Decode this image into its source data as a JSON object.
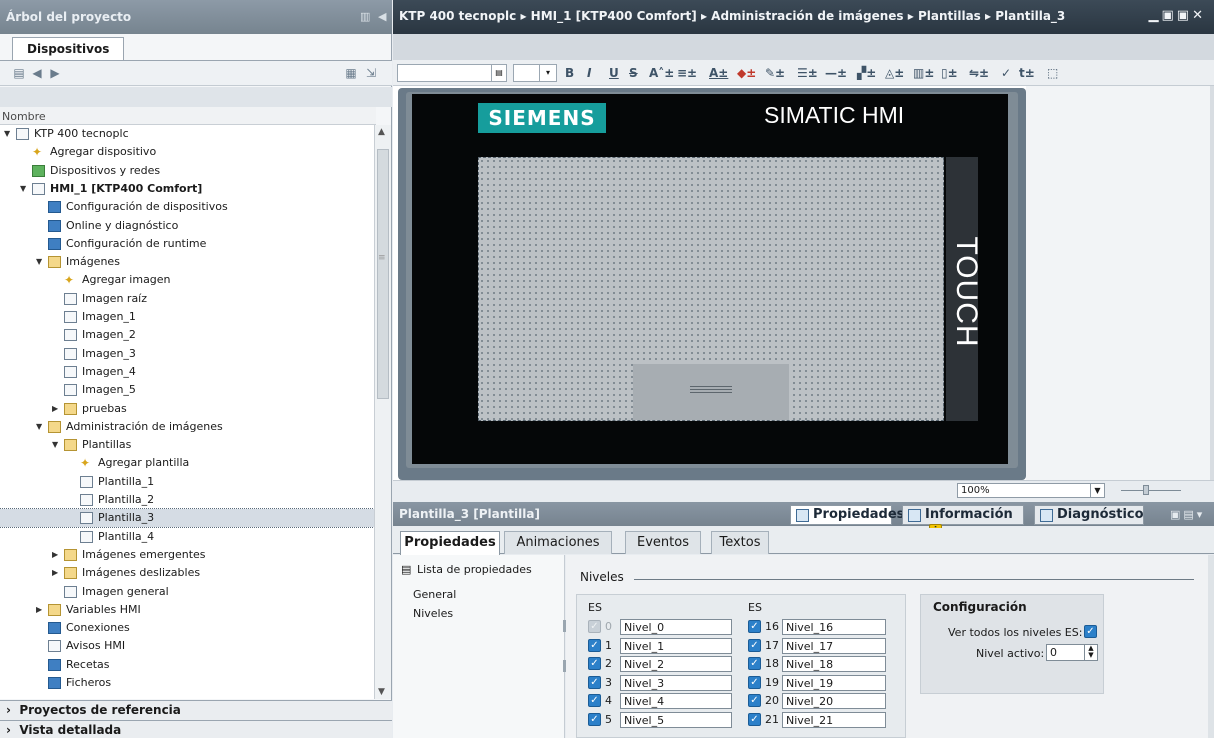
{
  "left_panel": {
    "title": "Árbol del proyecto",
    "tab": "Dispositivos",
    "column_header": "Nombre",
    "tree": [
      {
        "label": "KTP 400 tecnoplc",
        "level": 0,
        "expand": "open",
        "icon": "page"
      },
      {
        "label": "Agregar dispositivo",
        "level": 1,
        "expand": "none",
        "icon": "star"
      },
      {
        "label": "Dispositivos y redes",
        "level": 1,
        "expand": "none",
        "icon": "green"
      },
      {
        "label": "HMI_1 [KTP400 Comfort]",
        "level": 1,
        "expand": "open",
        "icon": "page",
        "bold": true
      },
      {
        "label": "Configuración de dispositivos",
        "level": 2,
        "expand": "none",
        "icon": "blue"
      },
      {
        "label": "Online y diagnóstico",
        "level": 2,
        "expand": "none",
        "icon": "blue"
      },
      {
        "label": "Configuración de runtime",
        "level": 2,
        "expand": "none",
        "icon": "blue"
      },
      {
        "label": "Imágenes",
        "level": 2,
        "expand": "open",
        "icon": "folder"
      },
      {
        "label": "Agregar imagen",
        "level": 3,
        "expand": "none",
        "icon": "star"
      },
      {
        "label": "Imagen raíz",
        "level": 3,
        "expand": "none",
        "icon": "page"
      },
      {
        "label": "Imagen_1",
        "level": 3,
        "expand": "none",
        "icon": "page"
      },
      {
        "label": "Imagen_2",
        "level": 3,
        "expand": "none",
        "icon": "page"
      },
      {
        "label": "Imagen_3",
        "level": 3,
        "expand": "none",
        "icon": "page"
      },
      {
        "label": "Imagen_4",
        "level": 3,
        "expand": "none",
        "icon": "page"
      },
      {
        "label": "Imagen_5",
        "level": 3,
        "expand": "none",
        "icon": "page"
      },
      {
        "label": "pruebas",
        "level": 3,
        "expand": "closed",
        "icon": "folder"
      },
      {
        "label": "Administración de imágenes",
        "level": 2,
        "expand": "open",
        "icon": "folder"
      },
      {
        "label": "Plantillas",
        "level": 3,
        "expand": "open",
        "icon": "folder"
      },
      {
        "label": "Agregar plantilla",
        "level": 4,
        "expand": "none",
        "icon": "star"
      },
      {
        "label": "Plantilla_1",
        "level": 4,
        "expand": "none",
        "icon": "page"
      },
      {
        "label": "Plantilla_2",
        "level": 4,
        "expand": "none",
        "icon": "page"
      },
      {
        "label": "Plantilla_3",
        "level": 4,
        "expand": "none",
        "icon": "page",
        "selected": true
      },
      {
        "label": "Plantilla_4",
        "level": 4,
        "expand": "none",
        "icon": "page"
      },
      {
        "label": "Imágenes emergentes",
        "level": 3,
        "expand": "closed",
        "icon": "folder"
      },
      {
        "label": "Imágenes deslizables",
        "level": 3,
        "expand": "closed",
        "icon": "folder"
      },
      {
        "label": "Imagen general",
        "level": 3,
        "expand": "none",
        "icon": "page"
      },
      {
        "label": "Variables HMI",
        "level": 2,
        "expand": "closed",
        "icon": "folder"
      },
      {
        "label": "Conexiones",
        "level": 2,
        "expand": "none",
        "icon": "blue"
      },
      {
        "label": "Avisos HMI",
        "level": 2,
        "expand": "none",
        "icon": "page"
      },
      {
        "label": "Recetas",
        "level": 2,
        "expand": "none",
        "icon": "blue"
      },
      {
        "label": "Ficheros",
        "level": 2,
        "expand": "none",
        "icon": "blue"
      }
    ],
    "bottom_1": "Proyectos de referencia",
    "bottom_2": "Vista detallada"
  },
  "editor": {
    "breadcrumb": "KTP 400 tecnoplc ▸ HMI_1 [KTP400 Comfort] ▸ Administración de imágenes ▸ Plantillas ▸ Plantilla_3",
    "hmi_brand": "SIEMENS",
    "hmi_model": "SIMATIC HMI",
    "hmi_touch": "TOUCH",
    "zoom": "100%"
  },
  "properties": {
    "title": "Plantilla_3 [Plantilla]",
    "tab_propiedades": "Propiedades",
    "tab_informacion": "Información",
    "tab_diagnostico": "Diagnóstico",
    "subtabs": [
      "Propiedades",
      "Animaciones",
      "Eventos",
      "Textos"
    ],
    "lista_label": "Lista de propiedades",
    "list_items": [
      "General",
      "Niveles"
    ],
    "section": "Niveles",
    "es_label": "ES",
    "levels_left": [
      {
        "num": "0",
        "name": "Nivel_0",
        "checked": true,
        "disabled": true
      },
      {
        "num": "1",
        "name": "Nivel_1",
        "checked": true
      },
      {
        "num": "2",
        "name": "Nivel_2",
        "checked": true
      },
      {
        "num": "3",
        "name": "Nivel_3",
        "checked": true
      },
      {
        "num": "4",
        "name": "Nivel_4",
        "checked": true
      },
      {
        "num": "5",
        "name": "Nivel_5",
        "checked": true
      }
    ],
    "levels_right": [
      {
        "num": "16",
        "name": "Nivel_16",
        "checked": true
      },
      {
        "num": "17",
        "name": "Nivel_17",
        "checked": true
      },
      {
        "num": "18",
        "name": "Nivel_18",
        "checked": true
      },
      {
        "num": "19",
        "name": "Nivel_19",
        "checked": true
      },
      {
        "num": "20",
        "name": "Nivel_20",
        "checked": true
      },
      {
        "num": "21",
        "name": "Nivel_21",
        "checked": true
      }
    ],
    "config_title": "Configuración",
    "config_ver_todos": "Ver todos los niveles ES:",
    "config_nivel_activo": "Nivel activo:",
    "config_nivel_activo_value": "0"
  },
  "colors": {
    "siemens_teal": "#169d9c",
    "checkbox_blue": "#2c80c9",
    "title_dark": "#2a3641"
  }
}
